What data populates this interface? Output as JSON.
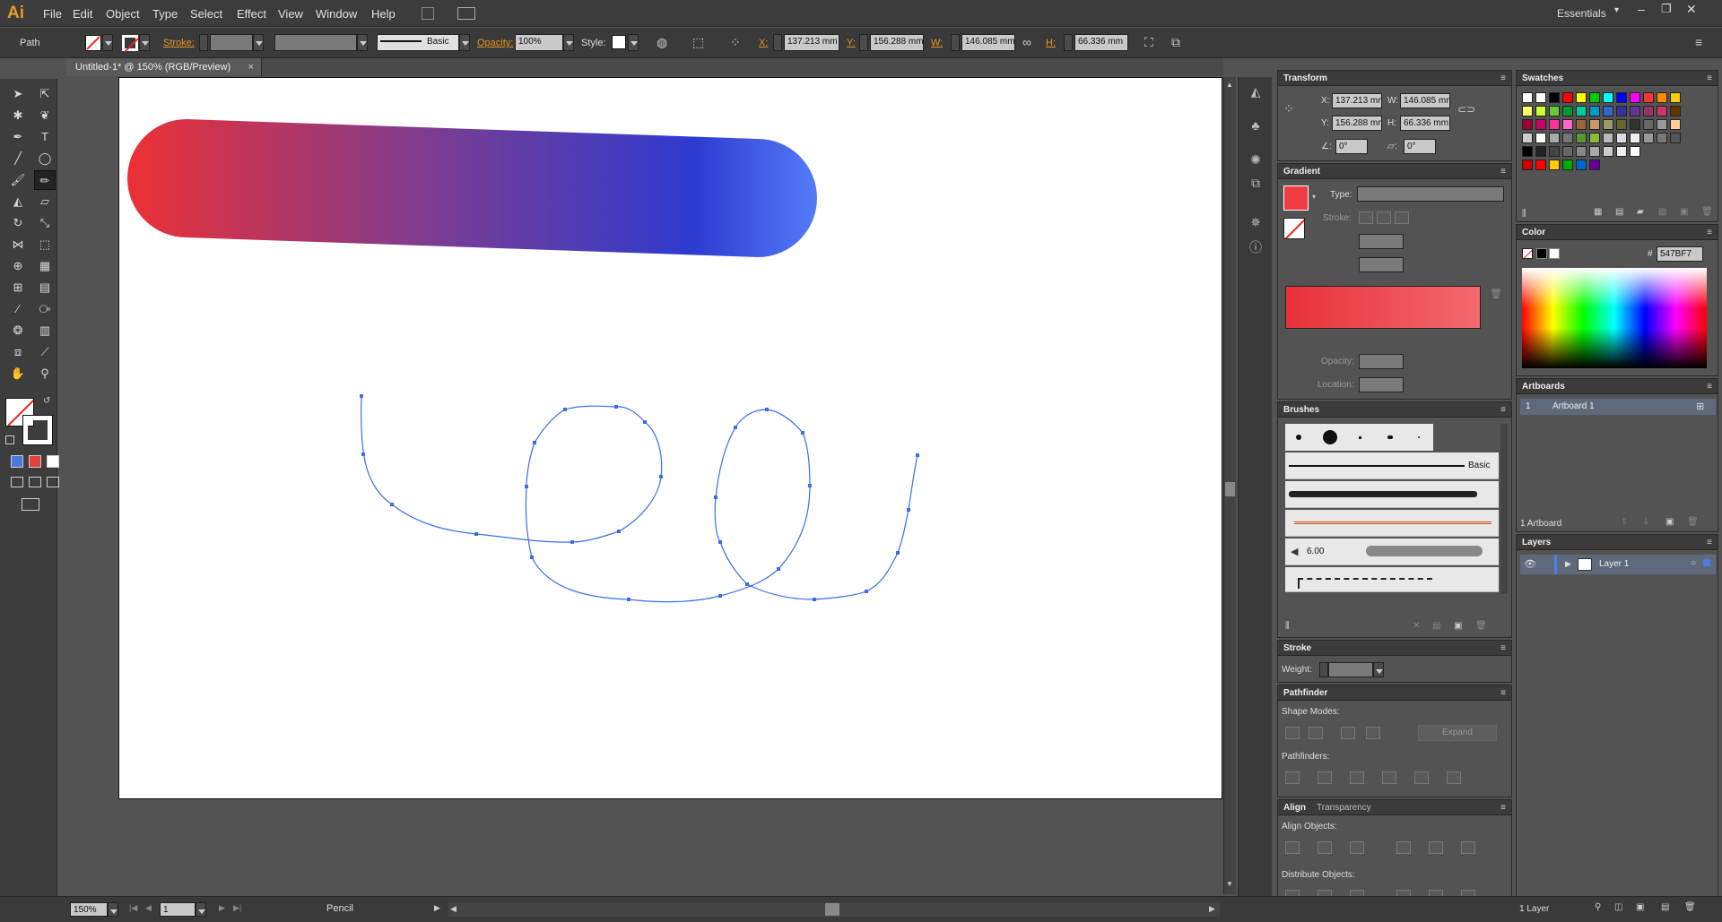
{
  "app": {
    "logo": "Ai"
  },
  "menu": [
    "File",
    "Edit",
    "Object",
    "Type",
    "Select",
    "Effect",
    "View",
    "Window",
    "Help"
  ],
  "workspace": "Essentials",
  "control": {
    "object_type": "Path",
    "stroke_label": "Stroke:",
    "brush_name": "Basic",
    "opacity_label": "Opacity:",
    "opacity_value": "100%",
    "style_label": "Style:",
    "x_label": "X:",
    "x_value": "137.213 mm",
    "y_label": "Y:",
    "y_value": "156.288 mm",
    "w_label": "W:",
    "w_value": "146.085 mm",
    "h_label": "H:",
    "h_value": "66.336 mm"
  },
  "document": {
    "tab_title": "Untitled-1* @ 150% (RGB/Preview)"
  },
  "panels": {
    "transform": {
      "title": "Transform",
      "x_label": "X:",
      "x": "137.213 mm",
      "w_label": "W:",
      "w": "146.085 mm",
      "y_label": "Y:",
      "y": "156.288 mm",
      "h_label": "H:",
      "h": "66.336 mm",
      "angle": "0°",
      "shear": "0°"
    },
    "gradient": {
      "title": "Gradient",
      "type_label": "Type:",
      "stroke_label": "Stroke:",
      "opacity_label": "Opacity:",
      "location_label": "Location:",
      "fill_color": "#ee3c42"
    },
    "brushes": {
      "title": "Brushes",
      "basic_label": "Basic",
      "size_label": "6.00"
    },
    "stroke": {
      "title": "Stroke",
      "weight_label": "Weight:"
    },
    "pathfinder": {
      "title": "Pathfinder",
      "shape_modes": "Shape Modes:",
      "expand": "Expand",
      "pathfinders": "Pathfinders:"
    },
    "align": {
      "title": "Align",
      "tab2": "Transparency",
      "align_objects": "Align Objects:",
      "distribute_objects": "Distribute Objects:"
    },
    "swatches": {
      "title": "Swatches"
    },
    "color": {
      "title": "Color",
      "hash": "#",
      "hex": "547BF7"
    },
    "artboards": {
      "title": "Artboards",
      "num": "1",
      "name": "Artboard 1",
      "count": "1 Artboard"
    },
    "layers": {
      "title": "Layers",
      "layer_name": "Layer 1",
      "count": "1 Layer"
    }
  },
  "status": {
    "zoom": "150%",
    "page": "1",
    "tool": "Pencil"
  },
  "colors": {
    "gradient_start": "#ec3034",
    "gradient_mid": "#7a3c93",
    "gradient_end": "#2d3bd0",
    "gradient_highlight": "#547bf7",
    "path_blue": "#3a6ee8"
  }
}
